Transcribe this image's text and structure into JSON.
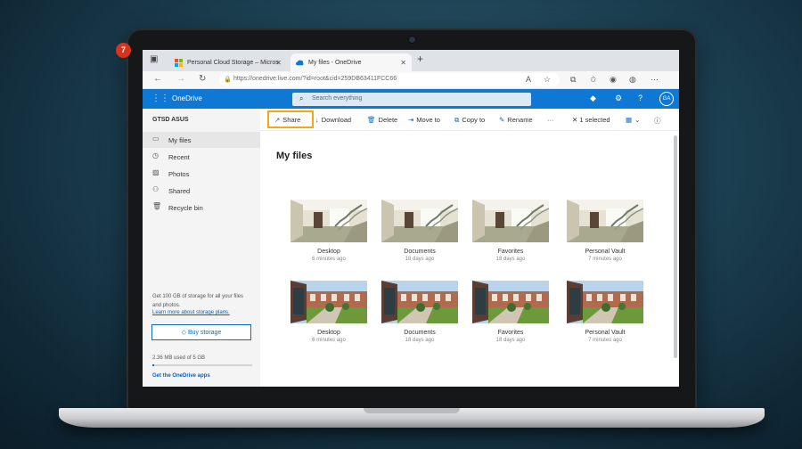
{
  "browser": {
    "tabs": [
      {
        "label": "Personal Cloud Storage – Micros"
      },
      {
        "label": "My files - OneDrive"
      }
    ],
    "url": "https://onedrive.live.com/?id=root&cid=259DB63411FCC66"
  },
  "onedrive": {
    "brand": "OneDrive",
    "search_placeholder": "Search everything",
    "avatar_initials": "GA"
  },
  "sidebar": {
    "user": "GTSD ASUS",
    "items": [
      {
        "label": "My files",
        "icon": "folder-icon"
      },
      {
        "label": "Recent",
        "icon": "clock-icon"
      },
      {
        "label": "Photos",
        "icon": "image-icon"
      },
      {
        "label": "Shared",
        "icon": "people-icon"
      },
      {
        "label": "Recycle bin",
        "icon": "trash-icon"
      }
    ],
    "promo": "Get 100 GB of storage for all your files and photos.",
    "learn_more": "Learn more about storage plans.",
    "buy_storage": "Buy storage",
    "usage": "2.36 MB used of 5 GB",
    "usage_fraction": 0.0005,
    "apps_link": "Get the OneDrive apps"
  },
  "commands": {
    "share": "Share",
    "download": "Download",
    "delete": "Delete",
    "move_to": "Move to",
    "copy_to": "Copy to",
    "rename": "Rename",
    "more": "···",
    "selected": "1 selected"
  },
  "step_badge": "7",
  "main": {
    "title": "My files",
    "rows": [
      [
        {
          "name": "Desktop",
          "date": "6 minutes ago"
        },
        {
          "name": "Documents",
          "date": "18 days ago"
        },
        {
          "name": "Favorites",
          "date": "18 days ago"
        },
        {
          "name": "Personal Vault",
          "date": "7 minutes ago"
        }
      ],
      [
        {
          "name": "Desktop",
          "date": "6 minutes ago"
        },
        {
          "name": "Documents",
          "date": "18 days ago"
        },
        {
          "name": "Favorites",
          "date": "18 days ago"
        },
        {
          "name": "Personal Vault",
          "date": "7 minutes ago"
        }
      ]
    ]
  },
  "colors": {
    "accent": "#0f78d4",
    "highlight": "#f3a51b",
    "badge": "#d6341f"
  }
}
